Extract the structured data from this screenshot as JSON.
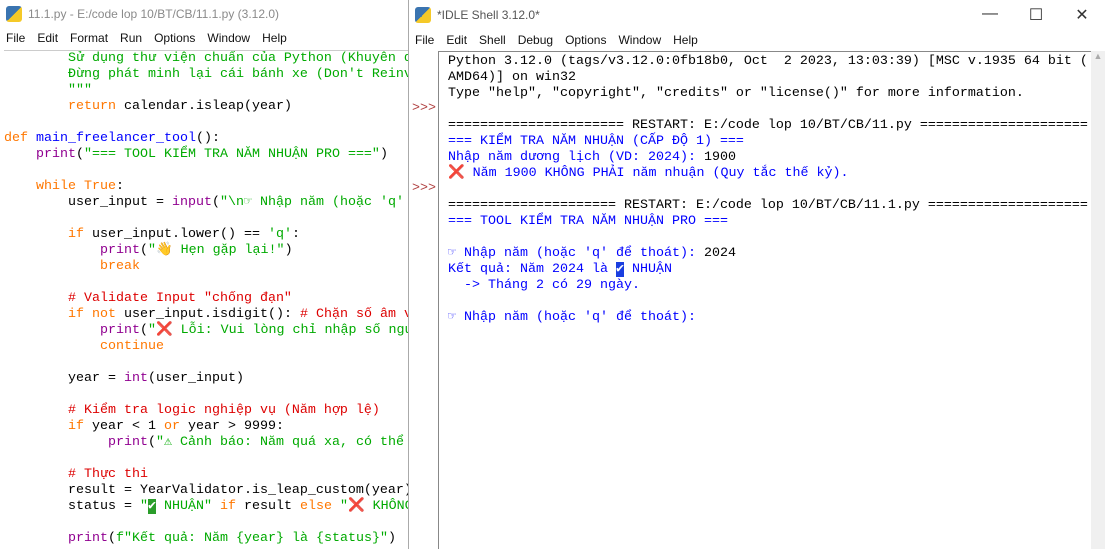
{
  "editor": {
    "title": "11.1.py - E:/code lop 10/BT/CB/11.1.py (3.12.0)",
    "menu": [
      "File",
      "Edit",
      "Format",
      "Run",
      "Options",
      "Window",
      "Help"
    ],
    "lines": [
      [
        [
          "        Sử dụng thư viện chuẩn của Python (Khuyên dùng",
          "st"
        ]
      ],
      [
        [
          "        Đừng phát minh lại cái bánh xe (Don't Reinvent",
          "st"
        ]
      ],
      [
        [
          "        \"\"\"",
          "st"
        ]
      ],
      [
        [
          "        ",
          "tx"
        ],
        [
          "return",
          "kw"
        ],
        [
          " calendar.isleap(year)",
          "tx"
        ]
      ],
      [],
      [
        [
          "def ",
          "kw"
        ],
        [
          "main_freelancer_tool",
          "df"
        ],
        [
          "():",
          "tx"
        ]
      ],
      [
        [
          "    ",
          "tx"
        ],
        [
          "print",
          "bi"
        ],
        [
          "(",
          "tx"
        ],
        [
          "\"=== TOOL KIỂM TRA NĂM NHUẬN PRO ===\"",
          "st"
        ],
        [
          ")",
          "tx"
        ]
      ],
      [],
      [
        [
          "    ",
          "tx"
        ],
        [
          "while True",
          "kw"
        ],
        [
          ":",
          "tx"
        ]
      ],
      [
        [
          "        user_input = ",
          "tx"
        ],
        [
          "input",
          "bi"
        ],
        [
          "(",
          "tx"
        ],
        [
          "\"\\n☞ Nhập năm (hoặc 'q' để thoát): \"",
          "st"
        ]
      ],
      [],
      [
        [
          "        ",
          "tx"
        ],
        [
          "if",
          "kw"
        ],
        [
          " user_input.lower() == ",
          "tx"
        ],
        [
          "'q'",
          "st"
        ],
        [
          ":",
          "tx"
        ]
      ],
      [
        [
          "            ",
          "tx"
        ],
        [
          "print",
          "bi"
        ],
        [
          "(",
          "tx"
        ],
        [
          "\"👋 Hẹn gặp lại!\"",
          "st"
        ],
        [
          ")",
          "tx"
        ]
      ],
      [
        [
          "            ",
          "tx"
        ],
        [
          "break",
          "kw"
        ]
      ],
      [],
      [
        [
          "        # Validate Input \"chống đạn\"",
          "cm"
        ]
      ],
      [
        [
          "        ",
          "tx"
        ],
        [
          "if not",
          "kw"
        ],
        [
          " user_input.isdigit(): ",
          "tx"
        ],
        [
          "# Chặn số âm và chữ",
          "cm"
        ]
      ],
      [
        [
          "            ",
          "tx"
        ],
        [
          "print",
          "bi"
        ],
        [
          "(",
          "tx"
        ],
        [
          "\"❌ Lỗi: Vui lòng chỉ nhập số nguyên dương!\"",
          "st"
        ]
      ],
      [
        [
          "            ",
          "tx"
        ],
        [
          "continue",
          "kw"
        ]
      ],
      [],
      [
        [
          "        year = ",
          "tx"
        ],
        [
          "int",
          "bi"
        ],
        [
          "(user_input)",
          "tx"
        ]
      ],
      [],
      [
        [
          "        # Kiểm tra logic nghiệp vụ (Năm hợp lệ)",
          "cm"
        ]
      ],
      [
        [
          "        ",
          "tx"
        ],
        [
          "if",
          "kw"
        ],
        [
          " year < 1 ",
          "tx"
        ],
        [
          "or",
          "kw"
        ],
        [
          " year > 9999:",
          "tx"
        ]
      ],
      [
        [
          "             ",
          "tx"
        ],
        [
          "print",
          "bi"
        ],
        [
          "(",
          "tx"
        ],
        [
          "\"⚠ Cảnh báo: Năm quá xa, có thể không chính xác\"",
          "st"
        ]
      ],
      [],
      [
        [
          "        # Thực thi",
          "cm"
        ]
      ],
      [
        [
          "        result = YearValidator.is_leap_custom(year)",
          "tx"
        ]
      ],
      [
        [
          "        status = ",
          "tx"
        ],
        [
          "\"",
          "st"
        ],
        [
          "✔",
          "ok"
        ],
        [
          " NHUẬN\"",
          "st"
        ],
        [
          " if",
          "kw"
        ],
        [
          " result ",
          "tx"
        ],
        [
          "else",
          "kw"
        ],
        [
          " \"❌ KHÔNG NHUẬN\"",
          "st"
        ]
      ],
      [],
      [
        [
          "        ",
          "tx"
        ],
        [
          "print",
          "bi"
        ],
        [
          "(",
          "tx"
        ],
        [
          "f\"Kết quả: Năm {year} là {status}\"",
          "st"
        ],
        [
          ")",
          "tx"
        ]
      ]
    ]
  },
  "shell": {
    "title": "*IDLE Shell 3.12.0*",
    "menu": [
      "File",
      "Edit",
      "Shell",
      "Debug",
      "Options",
      "Window",
      "Help"
    ],
    "window_controls": [
      "—",
      "☐",
      "✕"
    ],
    "prompts": [
      "",
      "",
      "",
      ">>>",
      "",
      "",
      "",
      "",
      ">>>"
    ],
    "scroll_arrow": "▲",
    "lines": [
      [
        [
          "Python 3.12.0 (tags/v3.12.0:0fb18b0, Oct  2 2023, 13:03:39) [MSC v.1935 64 bit (",
          "tx"
        ]
      ],
      [
        [
          "AMD64)] on win32",
          "tx"
        ]
      ],
      [
        [
          "Type \"help\", \"copyright\", \"credits\" or \"license()\" for more information.",
          "tx"
        ]
      ],
      [],
      [
        [
          "====================== RESTART: E:/code lop 10/BT/CB/11.py =====================",
          "tx"
        ]
      ],
      [
        [
          "=== KIỂM TRA NĂM NHUẬN (CẤP ĐỘ 1) ===",
          "out"
        ]
      ],
      [
        [
          "Nhập năm dương lịch (VD: 2024): ",
          "out"
        ],
        [
          "1900",
          "tx"
        ]
      ],
      [
        [
          "❌ Năm 1900 KHÔNG PHẢI năm nhuận (Quy tắc thế kỷ).",
          "out"
        ]
      ],
      [],
      [
        [
          "===================== RESTART: E:/code lop 10/BT/CB/11.1.py ====================",
          "tx"
        ]
      ],
      [
        [
          "=== TOOL KIỂM TRA NĂM NHUẬN PRO ===",
          "out"
        ]
      ],
      [],
      [
        [
          "☞ Nhập năm (hoặc 'q' để thoát): ",
          "out"
        ],
        [
          "2024",
          "tx"
        ]
      ],
      [
        [
          "Kết quả: Năm 2024 là ",
          "out"
        ],
        [
          "✔",
          "okb"
        ],
        [
          " NHUẬN",
          "out"
        ]
      ],
      [
        [
          "  -> Tháng 2 có 29 ngày.",
          "out"
        ]
      ],
      [],
      [
        [
          "☞ Nhập năm (hoặc 'q' để thoát): ",
          "out"
        ]
      ]
    ]
  }
}
